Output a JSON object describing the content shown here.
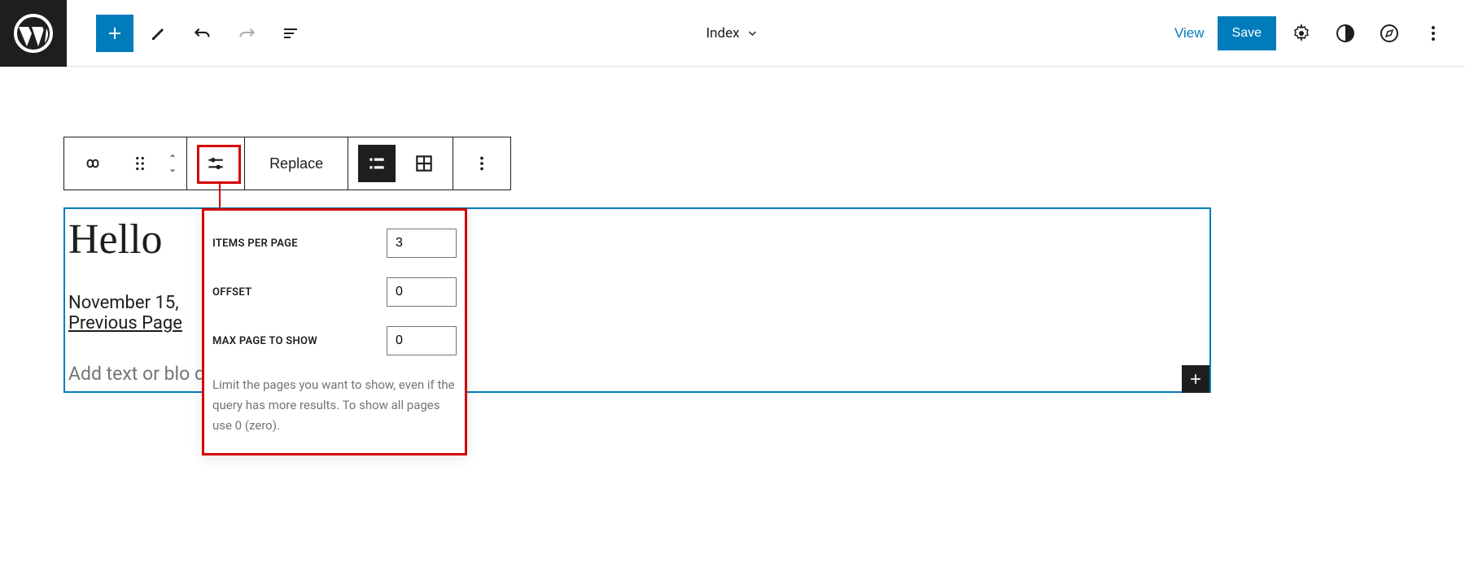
{
  "topbar": {
    "template_name": "Index",
    "view_label": "View",
    "save_label": "Save"
  },
  "toolbar": {
    "replace_label": "Replace"
  },
  "popover": {
    "items_per_page_label": "ITEMS PER PAGE",
    "items_per_page_value": "3",
    "offset_label": "OFFSET",
    "offset_value": "0",
    "max_page_label": "MAX PAGE TO SHOW",
    "max_page_value": "0",
    "help_text": "Limit the pages you want to show, even if the query has more results. To show all pages use 0 (zero)."
  },
  "content": {
    "heading": "Hello",
    "date": "November 15,",
    "prev_link": "Previous Page",
    "no_results_placeholder": "Add text or blo                                                         query returns no results."
  }
}
